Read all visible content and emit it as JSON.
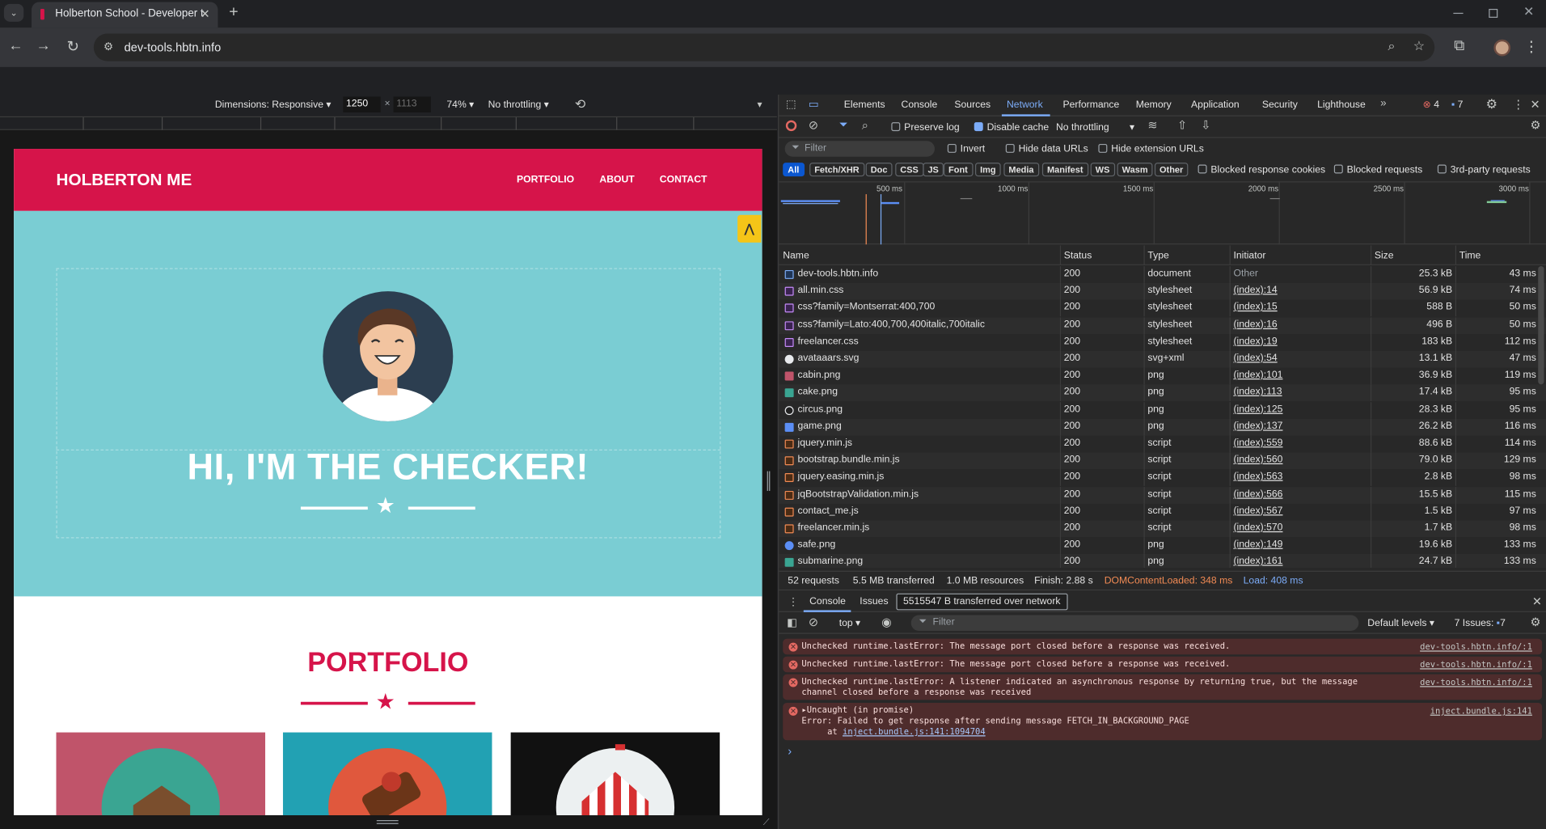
{
  "browser": {
    "tab_title": "Holberton School - Developer t",
    "url": "dev-tools.hbtn.info"
  },
  "device_toolbar": {
    "dimensions": "Dimensions: Responsive",
    "width": "1250",
    "height_placeholder": "1113",
    "times": "×",
    "zoom": "74%",
    "throttle": "No throttling"
  },
  "site": {
    "brand": "HOLBERTON ME",
    "nav": [
      "PORTFOLIO",
      "ABOUT",
      "CONTACT"
    ],
    "hero_title": "HI, I'M THE CHECKER!",
    "portfolio_title": "PORTFOLIO"
  },
  "devtools": {
    "tabs": [
      "Elements",
      "Console",
      "Sources",
      "Network",
      "Performance",
      "Memory",
      "Application",
      "Security",
      "Lighthouse"
    ],
    "active_tab": "Network",
    "error_count": "4",
    "issue_count": "7",
    "network_toolbar": {
      "preserve_log": "Preserve log",
      "disable_cache": "Disable cache",
      "throttle": "No throttling"
    },
    "filter": {
      "placeholder": "Filter",
      "invert": "Invert",
      "hide_data_urls": "Hide data URLs",
      "hide_extension_urls": "Hide extension URLs"
    },
    "type_filters": [
      "All",
      "Fetch/XHR",
      "Doc",
      "CSS",
      "JS",
      "Font",
      "Img",
      "Media",
      "Manifest",
      "WS",
      "Wasm",
      "Other"
    ],
    "extra_filters": [
      "Blocked response cookies",
      "Blocked requests",
      "3rd-party requests"
    ],
    "timeline_ticks": [
      "500 ms",
      "1000 ms",
      "1500 ms",
      "2000 ms",
      "2500 ms",
      "3000 ms"
    ],
    "columns": [
      "Name",
      "Status",
      "Type",
      "Initiator",
      "Size",
      "Time"
    ],
    "requests": [
      {
        "name": "dev-tools.hbtn.info",
        "status": "200",
        "type": "document",
        "initiator": "Other",
        "size": "25.3 kB",
        "time": "43 ms",
        "icon": "doc",
        "link": false
      },
      {
        "name": "all.min.css",
        "status": "200",
        "type": "stylesheet",
        "initiator": "(index):14",
        "size": "56.9 kB",
        "time": "74 ms",
        "icon": "css",
        "link": true
      },
      {
        "name": "css?family=Montserrat:400,700",
        "status": "200",
        "type": "stylesheet",
        "initiator": "(index):15",
        "size": "588 B",
        "time": "50 ms",
        "icon": "css",
        "link": true
      },
      {
        "name": "css?family=Lato:400,700,400italic,700italic",
        "status": "200",
        "type": "stylesheet",
        "initiator": "(index):16",
        "size": "496 B",
        "time": "50 ms",
        "icon": "css",
        "link": true
      },
      {
        "name": "freelancer.css",
        "status": "200",
        "type": "stylesheet",
        "initiator": "(index):19",
        "size": "183 kB",
        "time": "112 ms",
        "icon": "css",
        "link": true
      },
      {
        "name": "avataaars.svg",
        "status": "200",
        "type": "svg+xml",
        "initiator": "(index):54",
        "size": "13.1 kB",
        "time": "47 ms",
        "icon": "avatar",
        "link": true
      },
      {
        "name": "cabin.png",
        "status": "200",
        "type": "png",
        "initiator": "(index):101",
        "size": "36.9 kB",
        "time": "119 ms",
        "icon": "img-red",
        "link": true
      },
      {
        "name": "cake.png",
        "status": "200",
        "type": "png",
        "initiator": "(index):113",
        "size": "17.4 kB",
        "time": "95 ms",
        "icon": "img-teal",
        "link": true
      },
      {
        "name": "circus.png",
        "status": "200",
        "type": "png",
        "initiator": "(index):125",
        "size": "28.3 kB",
        "time": "95 ms",
        "icon": "img-dark",
        "link": true
      },
      {
        "name": "game.png",
        "status": "200",
        "type": "png",
        "initiator": "(index):137",
        "size": "26.2 kB",
        "time": "116 ms",
        "icon": "img-blue",
        "link": true
      },
      {
        "name": "jquery.min.js",
        "status": "200",
        "type": "script",
        "initiator": "(index):559",
        "size": "88.6 kB",
        "time": "114 ms",
        "icon": "js",
        "link": true
      },
      {
        "name": "bootstrap.bundle.min.js",
        "status": "200",
        "type": "script",
        "initiator": "(index):560",
        "size": "79.0 kB",
        "time": "129 ms",
        "icon": "js",
        "link": true
      },
      {
        "name": "jquery.easing.min.js",
        "status": "200",
        "type": "script",
        "initiator": "(index):563",
        "size": "2.8 kB",
        "time": "98 ms",
        "icon": "js",
        "link": true
      },
      {
        "name": "jqBootstrapValidation.min.js",
        "status": "200",
        "type": "script",
        "initiator": "(index):566",
        "size": "15.5 kB",
        "time": "115 ms",
        "icon": "js",
        "link": true
      },
      {
        "name": "contact_me.js",
        "status": "200",
        "type": "script",
        "initiator": "(index):567",
        "size": "1.5 kB",
        "time": "97 ms",
        "icon": "js",
        "link": true
      },
      {
        "name": "freelancer.min.js",
        "status": "200",
        "type": "script",
        "initiator": "(index):570",
        "size": "1.7 kB",
        "time": "98 ms",
        "icon": "js",
        "link": true
      },
      {
        "name": "safe.png",
        "status": "200",
        "type": "png",
        "initiator": "(index):149",
        "size": "19.6 kB",
        "time": "133 ms",
        "icon": "img-blue-dot",
        "link": true
      },
      {
        "name": "submarine.png",
        "status": "200",
        "type": "png",
        "initiator": "(index):161",
        "size": "24.7 kB",
        "time": "133 ms",
        "icon": "img-teal",
        "link": true
      }
    ],
    "summary": {
      "requests": "52 requests",
      "transferred": "5.5 MB transferred",
      "resources": "1.0 MB resources",
      "finish": "Finish: 2.88 s",
      "dcl": "DOMContentLoaded: 348 ms",
      "load": "Load: 408 ms"
    },
    "drawer": {
      "tabs": [
        "Console",
        "Issues"
      ],
      "tooltip": "5515547 B transferred over network",
      "context": "top",
      "filter_placeholder": "Filter",
      "levels": "Default levels",
      "issues": "7 Issues:",
      "issues_count": "7",
      "messages": [
        {
          "text": "Unchecked runtime.lastError: The message port closed before a response was received.",
          "source": "dev-tools.hbtn.info/:1"
        },
        {
          "text": "Unchecked runtime.lastError: The message port closed before a response was received.",
          "source": "dev-tools.hbtn.info/:1"
        },
        {
          "text": "Unchecked runtime.lastError: A listener indicated an asynchronous response by returning true, but the message",
          "text2": "channel closed before a response was received",
          "source": "dev-tools.hbtn.info/:1"
        }
      ],
      "uncaught": {
        "head": "Uncaught (in promise)",
        "line2": "Error: Failed to get response after sending message FETCH_IN_BACKGROUND_PAGE",
        "line3_prefix": "at ",
        "line3_link": "inject.bundle.js:141:1094704",
        "source": "inject.bundle.js:141"
      },
      "prompt": "›"
    }
  },
  "colors": {
    "brand_red": "#d6144a",
    "hero_teal": "#7acdd3",
    "devtools_bg": "#282828",
    "accent_blue": "#7cacf8",
    "error_bg": "#4e2c2c",
    "dcl_orange": "#f28b54"
  }
}
